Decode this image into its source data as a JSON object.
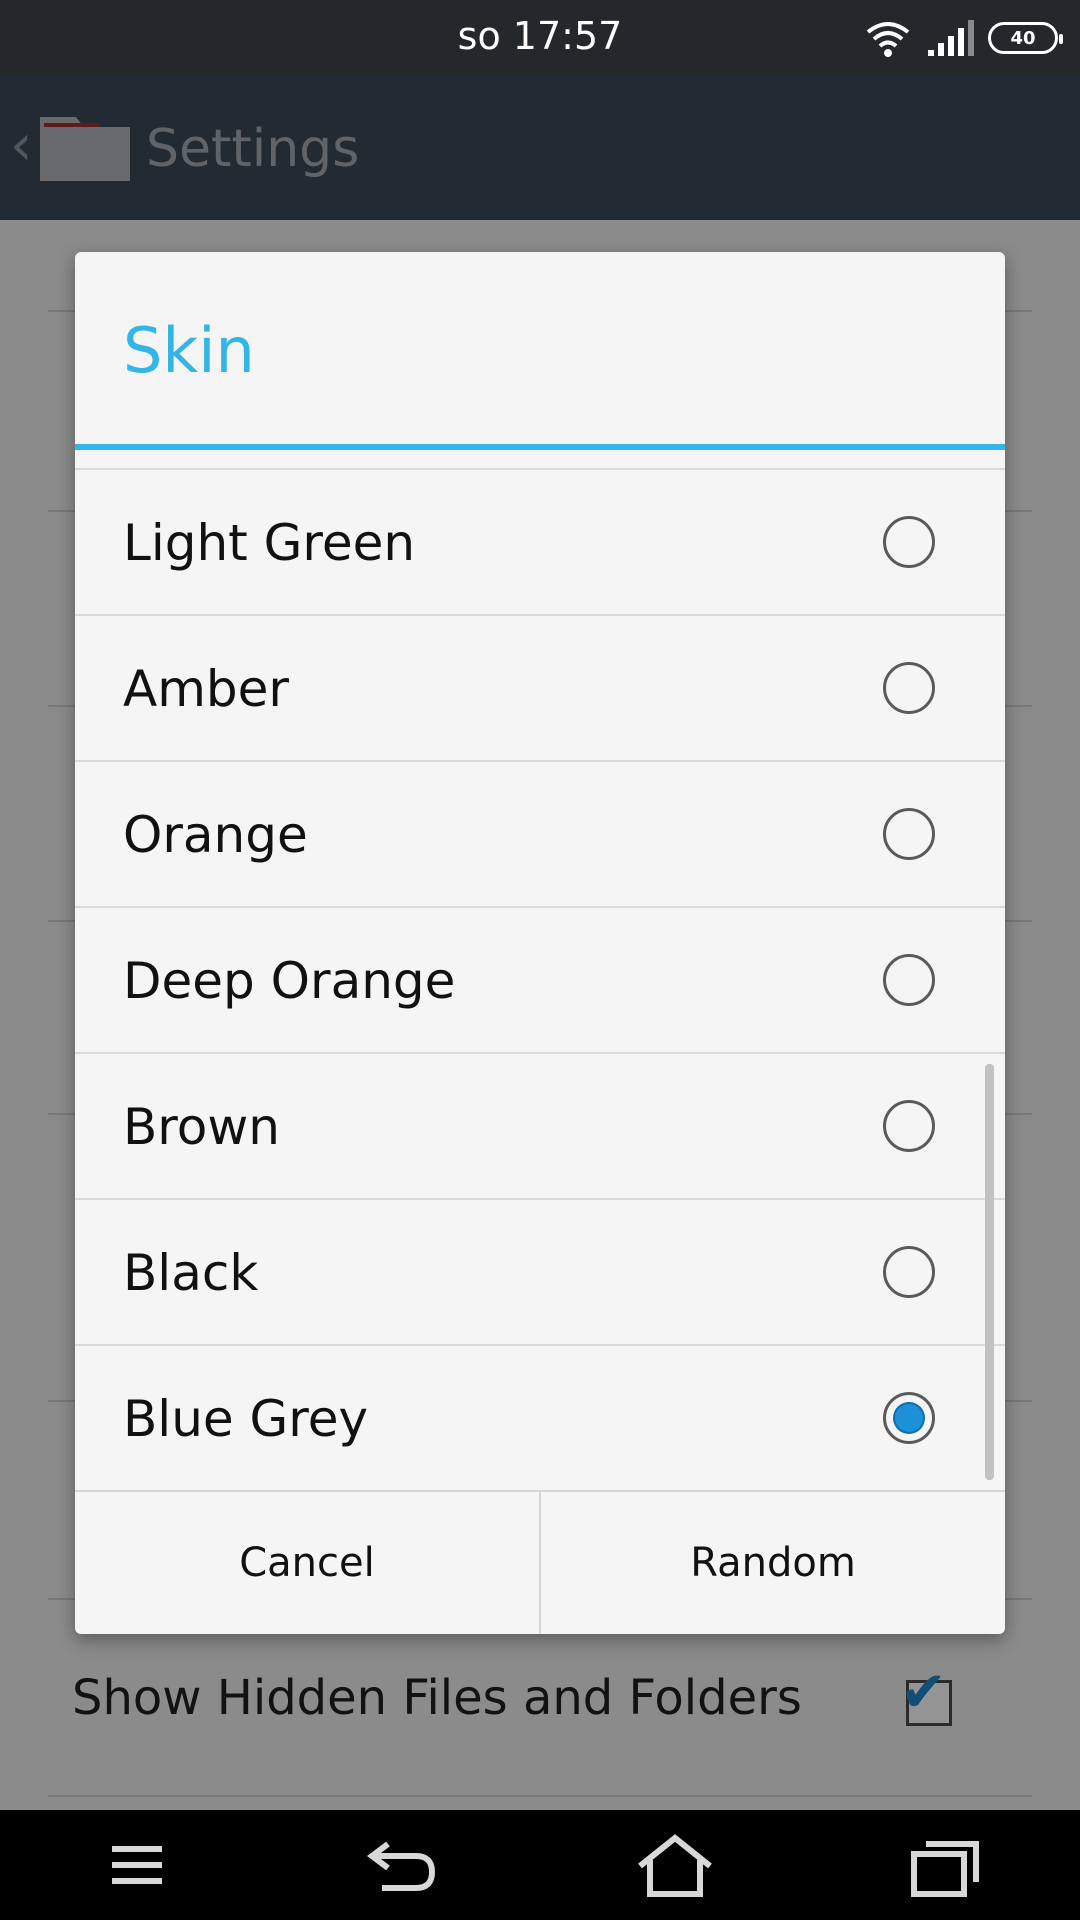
{
  "status_bar": {
    "time": "so 17:57",
    "battery": "40"
  },
  "app_bar": {
    "title": "Settings"
  },
  "background_setting": {
    "label": "Show Hidden Files and Folders",
    "checked": true
  },
  "dialog": {
    "title": "Skin",
    "options": [
      {
        "label": "Light Green",
        "selected": false
      },
      {
        "label": "Amber",
        "selected": false
      },
      {
        "label": "Orange",
        "selected": false
      },
      {
        "label": "Deep Orange",
        "selected": false
      },
      {
        "label": "Brown",
        "selected": false
      },
      {
        "label": "Black",
        "selected": false
      },
      {
        "label": "Blue Grey",
        "selected": true
      }
    ],
    "buttons": {
      "cancel": "Cancel",
      "random": "Random"
    }
  },
  "colors": {
    "accent": "#33b5e5",
    "radio_selected": "#1e90d8",
    "app_bar": "#3c4a5a",
    "status_bar": "#25282b"
  },
  "nav_icons": [
    "menu-icon",
    "back-icon",
    "home-icon",
    "recents-icon"
  ]
}
